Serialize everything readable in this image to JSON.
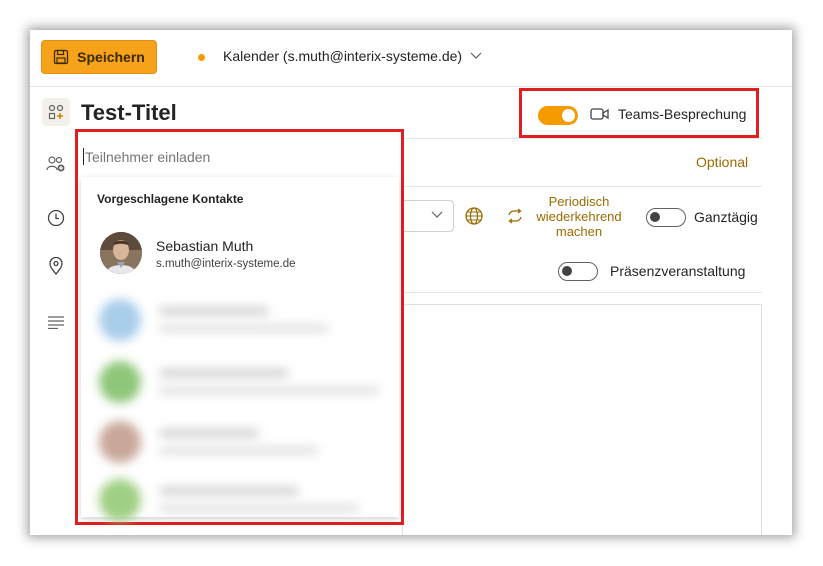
{
  "toolbar": {
    "save_label": "Speichern",
    "calendar_label": "Kalender (s.muth@interix-systeme.de)"
  },
  "event": {
    "title": "Test-Titel"
  },
  "teams": {
    "label": "Teams-Besprechung",
    "enabled": true
  },
  "attendees": {
    "placeholder": "Teilnehmer einladen",
    "optional_label": "Optional",
    "suggested_heading": "Vorgeschlagene Kontakte",
    "contacts": [
      {
        "name": "Sebastian Muth",
        "email": "s.muth@interix-systeme.de"
      }
    ]
  },
  "schedule": {
    "recurring_label": "Periodisch wiederkehrend machen",
    "all_day_label": "Ganztägig",
    "in_person_label": "Präsenzveranstaltung"
  },
  "colors": {
    "accent": "#f59b00",
    "highlight_border": "#e02020",
    "link_text": "#9a6b00"
  }
}
